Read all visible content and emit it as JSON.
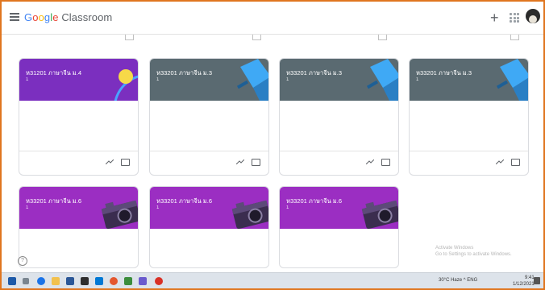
{
  "app": {
    "title": "Google Classroom",
    "logo_word1": "Google",
    "logo_word2": "Classroom"
  },
  "topbar": {
    "add_label": "+"
  },
  "cards": [
    {
      "title": "ห31201 ภาษาจีน ม.4",
      "sub": "1",
      "theme": "purple"
    },
    {
      "title": "ห33201 ภาษาจีน ม.3",
      "sub": "1",
      "theme": "slate"
    },
    {
      "title": "ห33201 ภาษาจีน ม.3",
      "sub": "1",
      "theme": "slate"
    },
    {
      "title": "ห33201 ภาษาจีน ม.3",
      "sub": "1",
      "theme": "slate"
    },
    {
      "title": "ห33201 ภาษาจีน ม.6",
      "sub": "1",
      "theme": "magenta"
    },
    {
      "title": "ห33201 ภาษาจีน ม.6",
      "sub": "1",
      "theme": "magenta"
    },
    {
      "title": "ห33201 ภาษาจีน ม.6",
      "sub": "1",
      "theme": "magenta"
    }
  ],
  "help": {
    "label": "?"
  },
  "watermark": {
    "line1": "Activate Windows",
    "line2": "Go to Settings to activate Windows."
  },
  "taskbar": {
    "tray": "30°C Haze  ^ ENG",
    "time": "9:41",
    "date": "1/12/2021"
  },
  "colors": {
    "purple": "#7b2fbf",
    "slate": "#5a6a71",
    "magenta": "#9b2ec2",
    "frame": "#e0761f"
  }
}
